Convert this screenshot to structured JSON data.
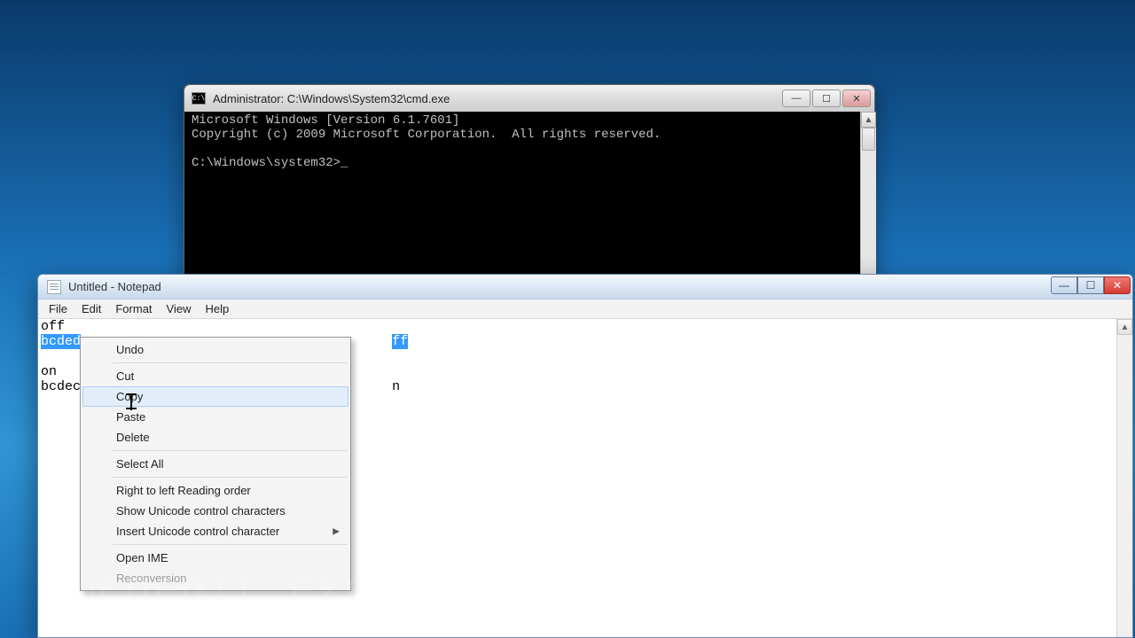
{
  "cmd": {
    "title": "Administrator: C:\\Windows\\System32\\cmd.exe",
    "icon_label": "C:\\",
    "line1": "Microsoft Windows [Version 6.1.7601]",
    "line2": "Copyright (c) 2009 Microsoft Corporation.  All rights reserved.",
    "line3": "",
    "prompt": "C:\\Windows\\system32>",
    "cursor": "_",
    "btn_min": "—",
    "btn_max": "☐",
    "btn_close": "✕",
    "scroll_up": "▲",
    "scroll_down": "▼"
  },
  "notepad": {
    "title": "Untitled - Notepad",
    "menu": {
      "file": "File",
      "edit": "Edit",
      "format": "Format",
      "view": "View",
      "help": "Help"
    },
    "content": {
      "l1": "off",
      "l2_selected_a": "bcded",
      "l2_selected_b": "ff",
      "l3": "",
      "l4": "on",
      "l5": "bcdec                                       n"
    },
    "btn_min": "—",
    "btn_max": "☐",
    "btn_close": "✕",
    "scroll_up": "▲"
  },
  "context_menu": {
    "undo": "Undo",
    "cut": "Cut",
    "copy": "Copy",
    "paste": "Paste",
    "delete": "Delete",
    "select_all": "Select All",
    "rtl": "Right to left Reading order",
    "show_unicode": "Show Unicode control characters",
    "insert_unicode": "Insert Unicode control character",
    "open_ime": "Open IME",
    "reconversion": "Reconversion",
    "submenu_arrow": "▶"
  },
  "watermark": "bcdedit.exe /set {current} nx AlwaysOff"
}
